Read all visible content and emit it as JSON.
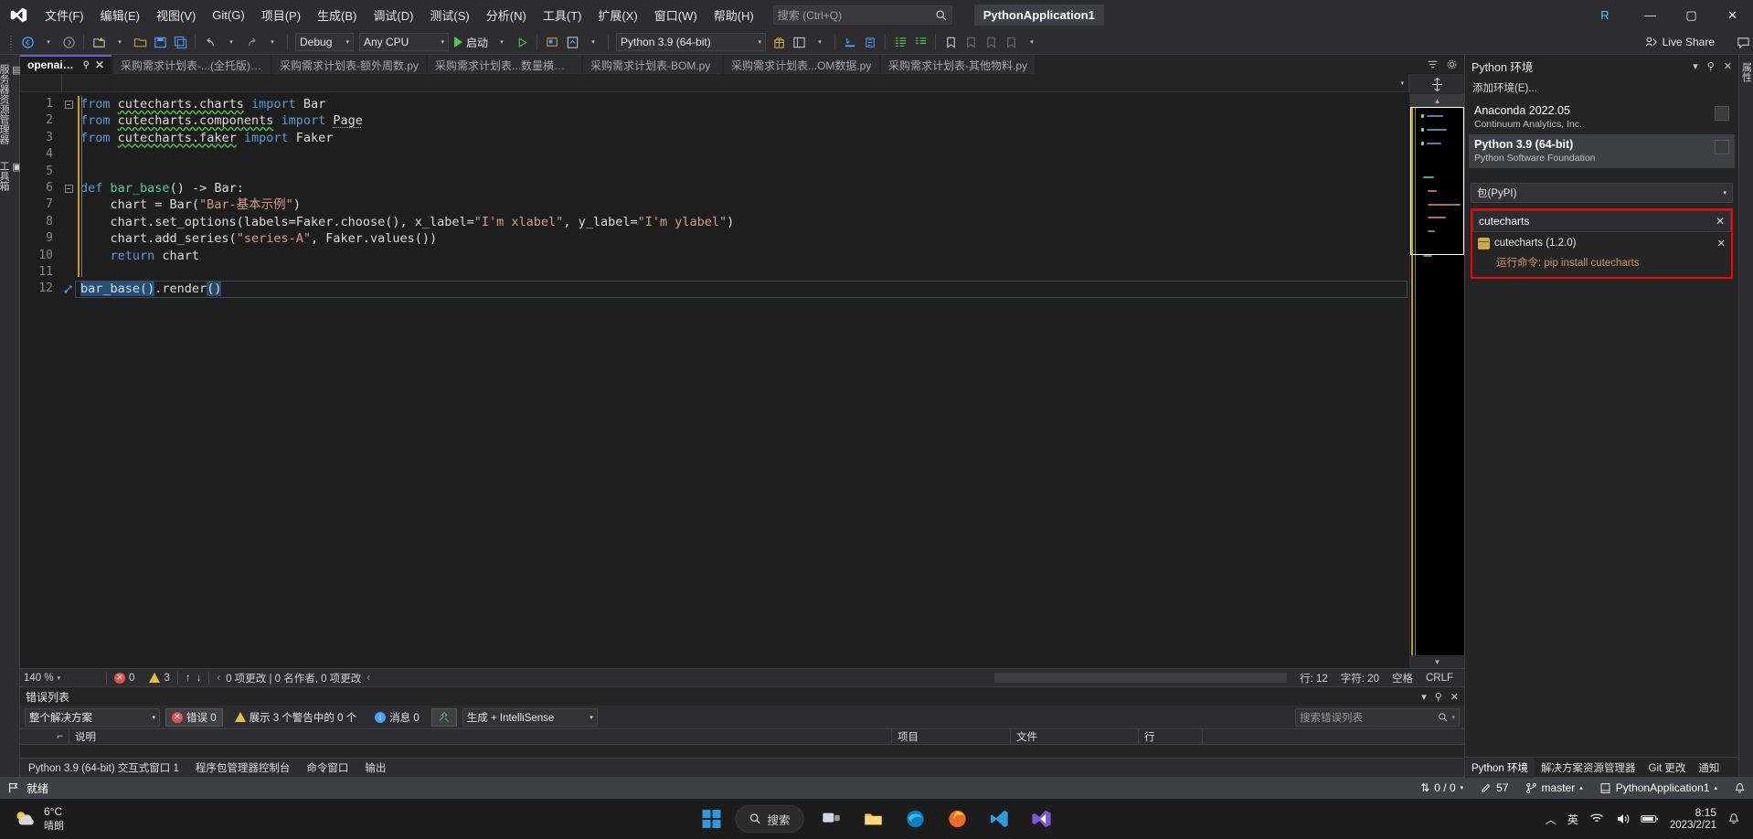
{
  "titlebar": {
    "menus": [
      "文件(F)",
      "编辑(E)",
      "视图(V)",
      "Git(G)",
      "项目(P)",
      "生成(B)",
      "调试(D)",
      "测试(S)",
      "分析(N)",
      "工具(T)",
      "扩展(X)",
      "窗口(W)",
      "帮助(H)"
    ],
    "search_placeholder": "搜索 (Ctrl+Q)",
    "project_name": "PythonApplication1",
    "account_initial": "R",
    "minimize": "—",
    "maximize": "▢",
    "close": "✕"
  },
  "toolbar": {
    "config": "Debug",
    "platform": "Any CPU",
    "run_label": "启动",
    "interpreter": "Python 3.9 (64-bit)",
    "live_share": "Live Share"
  },
  "tabs": [
    {
      "label": "openai.py*",
      "active": true
    },
    {
      "label": "采购需求计划表-...(全托版).py",
      "active": false
    },
    {
      "label": "采购需求计划表-额外周数.py",
      "active": false
    },
    {
      "label": "采购需求计划表...数量横表.py",
      "active": false
    },
    {
      "label": "采购需求计划表-BOM.py",
      "active": false
    },
    {
      "label": "采购需求计划表...OM数据.py",
      "active": false
    },
    {
      "label": "采购需求计划表-其他物料.py",
      "active": false
    }
  ],
  "code": {
    "lines": [
      {
        "n": 1,
        "text": "from cutecharts.charts import Bar"
      },
      {
        "n": 2,
        "text": "from cutecharts.components import Page"
      },
      {
        "n": 3,
        "text": "from cutecharts.faker import Faker"
      },
      {
        "n": 4,
        "text": ""
      },
      {
        "n": 5,
        "text": ""
      },
      {
        "n": 6,
        "text": "def bar_base() -> Bar:"
      },
      {
        "n": 7,
        "text": "    chart = Bar(\"Bar-基本示例\")"
      },
      {
        "n": 8,
        "text": "    chart.set_options(labels=Faker.choose(), x_label=\"I'm xlabel\", y_label=\"I'm ylabel\")"
      },
      {
        "n": 9,
        "text": "    chart.add_series(\"series-A\", Faker.values())"
      },
      {
        "n": 10,
        "text": "    return chart"
      },
      {
        "n": 11,
        "text": ""
      },
      {
        "n": 12,
        "text": "bar_base().render()"
      }
    ]
  },
  "editor_status": {
    "zoom": "140 %",
    "error_count": "0",
    "warning_count": "3",
    "changes_label": "0 项更改 | 0 名作者, 0 项更改",
    "line": "行: 12",
    "col": "字符: 20",
    "spaces": "空格",
    "eol": "CRLF"
  },
  "error_panel": {
    "title": "错误列表",
    "scope": "整个解决方案",
    "errors_chip": "错误 0",
    "warnings_chip": "展示 3 个警告中的 0 个",
    "messages_chip": "消息 0",
    "build_filter": "生成 + IntelliSense",
    "search_placeholder": "搜索错误列表",
    "columns": [
      "",
      "说明",
      "项目",
      "文件",
      "行"
    ]
  },
  "bottom_tabs": [
    "Python 3.9 (64-bit) 交互式窗口 1",
    "程序包管理器控制台",
    "命令窗口",
    "输出"
  ],
  "right_dock": {
    "title": "Python 环境",
    "add_env": "添加环境(E)...",
    "environments": [
      {
        "name": "Anaconda 2022.05",
        "vendor": "Continuum Analytics, Inc.",
        "selected": false
      },
      {
        "name": "Python 3.9 (64-bit)",
        "vendor": "Python Software Foundation",
        "selected": true
      }
    ],
    "package_source": "包(PyPI)",
    "package_query": "cutecharts",
    "result_name": "cutecharts (1.2.0)",
    "result_command": "运行命令: pip install cutecharts",
    "highlight_color": "#ff0000",
    "bottom_tabs": [
      {
        "label": "Python 环境",
        "active": true
      },
      {
        "label": "解决方案资源管理器",
        "active": false
      },
      {
        "label": "Git 更改",
        "active": false
      },
      {
        "label": "通知",
        "active": false
      }
    ]
  },
  "left_strip": {
    "tabs": [
      "服务器资源管理器",
      "工具箱"
    ]
  },
  "right_edge": {
    "tabs": [
      "属性"
    ]
  },
  "vs_status": {
    "ready": "就绪",
    "changes": "0 / 0",
    "count": "57",
    "branch": "master",
    "repo": "PythonApplication1"
  },
  "taskbar": {
    "temperature": "6°C",
    "condition": "晴朗",
    "search_label": "搜索",
    "time": "8:15",
    "date": "2023/2/21",
    "lang": "英",
    "icons": [
      "start-icon",
      "search-icon",
      "task-view-icon",
      "file-explorer-icon",
      "edge-icon",
      "firefox-icon",
      "vscode-icon",
      "visual-studio-icon"
    ]
  }
}
